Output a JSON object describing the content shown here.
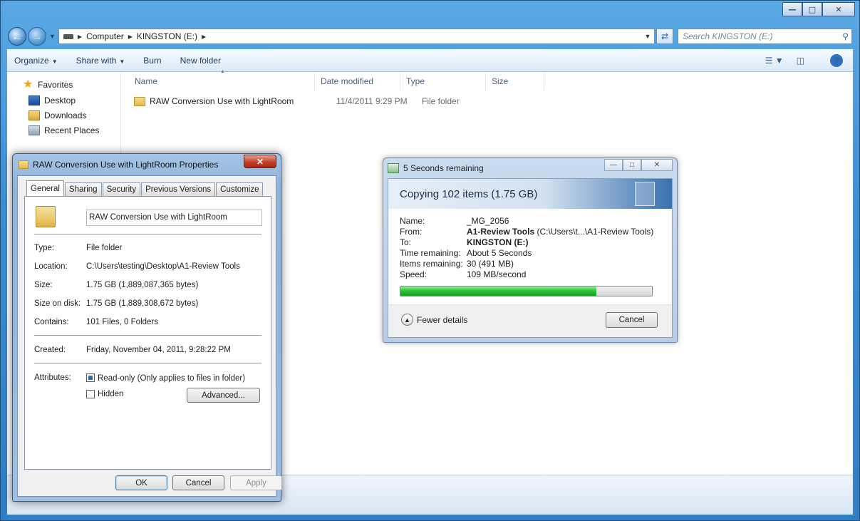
{
  "explorer": {
    "breadcrumb": [
      "Computer",
      "KINGSTON (E:)"
    ],
    "search_placeholder": "Search KINGSTON (E:)",
    "toolbar": {
      "organize": "Organize",
      "share_with": "Share with",
      "burn": "Burn",
      "new_folder": "New folder"
    },
    "nav": {
      "favorites": "Favorites",
      "desktop": "Desktop",
      "downloads": "Downloads",
      "recent_places": "Recent Places"
    },
    "columns": {
      "name": "Name",
      "date_modified": "Date modified",
      "type": "Type",
      "size": "Size"
    },
    "files": [
      {
        "name": "RAW Conversion Use with LightRoom",
        "date": "11/4/2011 9:29 PM",
        "type": "File folder",
        "size": ""
      }
    ]
  },
  "properties": {
    "title": "RAW Conversion Use with LightRoom Properties",
    "tabs": [
      "General",
      "Sharing",
      "Security",
      "Previous Versions",
      "Customize"
    ],
    "folder_name": "RAW Conversion Use with LightRoom",
    "type_label": "Type:",
    "type_value": "File folder",
    "location_label": "Location:",
    "location_value": "C:\\Users\\testing\\Desktop\\A1-Review Tools",
    "size_label": "Size:",
    "size_value": "1.75 GB (1,889,087,365 bytes)",
    "size_on_disk_label": "Size on disk:",
    "size_on_disk_value": "1.75 GB (1,889,308,672 bytes)",
    "contains_label": "Contains:",
    "contains_value": "101 Files, 0 Folders",
    "created_label": "Created:",
    "created_value": "Friday, November 04, 2011, 9:28:22 PM",
    "attributes_label": "Attributes:",
    "readonly_label": "Read-only (Only applies to files in folder)",
    "readonly_checked": true,
    "hidden_label": "Hidden",
    "hidden_checked": false,
    "advanced_button": "Advanced...",
    "ok_button": "OK",
    "cancel_button": "Cancel",
    "apply_button": "Apply"
  },
  "copy_dialog": {
    "title": "5 Seconds remaining",
    "banner": "Copying 102 items (1.75 GB)",
    "name_label": "Name:",
    "name_value": "_MG_2056",
    "from_label": "From:",
    "from_bold": "A1-Review Tools",
    "from_path": " (C:\\Users\\t...\\A1-Review Tools)",
    "to_label": "To:",
    "to_value": "KINGSTON (E:)",
    "time_label": "Time remaining:",
    "time_value": "About 5 Seconds",
    "items_label": "Items remaining:",
    "items_value": "30 (491 MB)",
    "speed_label": "Speed:",
    "speed_value": "109 MB/second",
    "progress_fraction": 0.78,
    "fewer_details": "Fewer details",
    "cancel_button": "Cancel"
  }
}
